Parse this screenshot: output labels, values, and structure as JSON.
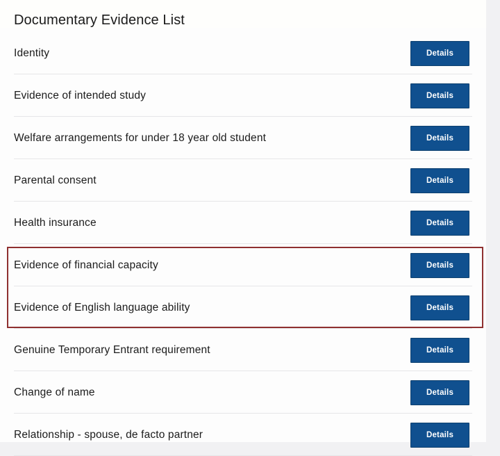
{
  "page": {
    "title": "Documentary Evidence List",
    "background_color": "#f1f1f3",
    "panel_color": "#fdfdfd"
  },
  "colors": {
    "button_blue": "#10508f",
    "button_border": "#0d406f",
    "highlight_red": "#8f3030",
    "divider": "#e6e6e8",
    "text": "#1b1b1b"
  },
  "highlight": {
    "annotation_shape": "rectangle",
    "covers_rows": [
      "Evidence of financial capacity",
      "Evidence of English language ability"
    ]
  },
  "evidence_list": {
    "action_label": "Details",
    "rows": [
      {
        "label": "Identity",
        "button": "Details",
        "highlighted": false
      },
      {
        "label": "Evidence of intended study",
        "button": "Details",
        "highlighted": false
      },
      {
        "label": "Welfare arrangements for under 18 year old student",
        "button": "Details",
        "highlighted": false
      },
      {
        "label": "Parental consent",
        "button": "Details",
        "highlighted": false
      },
      {
        "label": "Health insurance",
        "button": "Details",
        "highlighted": false
      },
      {
        "label": "Evidence of financial capacity",
        "button": "Details",
        "highlighted": true
      },
      {
        "label": "Evidence of English language ability",
        "button": "Details",
        "highlighted": true
      },
      {
        "label": "Genuine Temporary Entrant requirement",
        "button": "Details",
        "highlighted": false
      },
      {
        "label": "Change of name",
        "button": "Details",
        "highlighted": false
      },
      {
        "label": "Relationship - spouse, de facto partner",
        "button": "Details",
        "highlighted": false
      }
    ]
  }
}
